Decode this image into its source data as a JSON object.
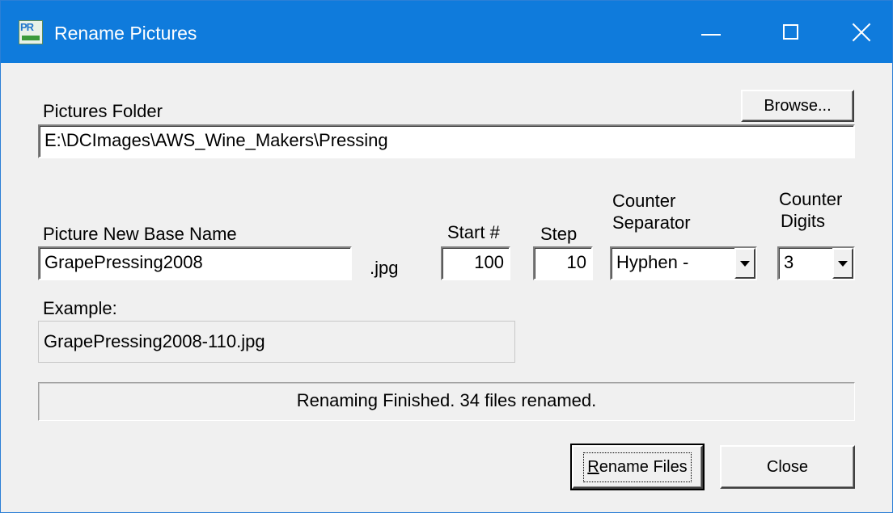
{
  "window": {
    "title": "Rename Pictures",
    "app_icon_text": "PR"
  },
  "folder": {
    "label": "Pictures Folder",
    "browse_label": "Browse...",
    "path": "E:\\DCImages\\AWS_Wine_Makers\\Pressing"
  },
  "base_name": {
    "label": "Picture New Base Name",
    "value": "GrapePressing2008",
    "extension": ".jpg"
  },
  "start": {
    "label": "Start #",
    "value": "100"
  },
  "step": {
    "label": "Step",
    "value": "10"
  },
  "separator": {
    "label_line1": "Counter",
    "label_line2": "Separator",
    "selected": "Hyphen -"
  },
  "digits": {
    "label_line1": "Counter",
    "label_line2": "Digits",
    "selected": "3"
  },
  "example": {
    "label": "Example:",
    "value": "GrapePressing2008-110.jpg"
  },
  "status": {
    "text": "Renaming Finished. 34 files renamed."
  },
  "buttons": {
    "rename_prefix": "R",
    "rename_rest": "ename Files",
    "close": "Close"
  },
  "colors": {
    "titlebar": "#0f7bdc",
    "dialog_bg": "#f0f0f0"
  }
}
